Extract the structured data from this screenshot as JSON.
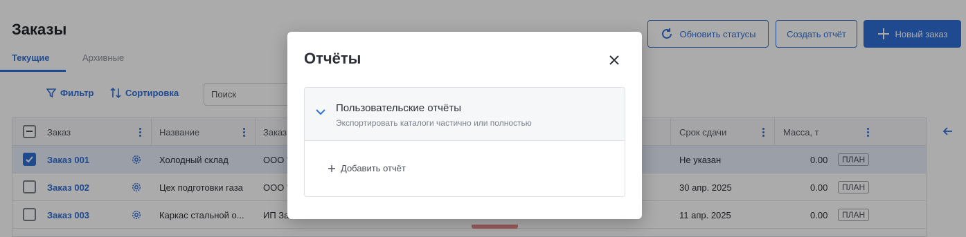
{
  "page": {
    "title": "Заказы",
    "tabs": [
      {
        "label": "Текущие",
        "active": true
      },
      {
        "label": "Архивные",
        "active": false
      }
    ]
  },
  "header_buttons": {
    "refresh": "Обновить статусы",
    "create_report": "Создать отчёт",
    "new_order": "Новый заказ"
  },
  "toolbar": {
    "filter": "Фильтр",
    "sort": "Сортировка",
    "search_placeholder": "Поиск"
  },
  "table": {
    "columns": {
      "order": "Заказ",
      "name": "Название",
      "customer": "Заказ",
      "deadline": "Срок сдачи",
      "mass": "Масса, т"
    },
    "rows": [
      {
        "order": "Заказ 001",
        "name": "Холодный склад",
        "customer": "ООО \"",
        "deadline": "Не указан",
        "mass": "0.00",
        "badge": "ПЛАН",
        "checked": true
      },
      {
        "order": "Заказ 002",
        "name": "Цех подготовки газа",
        "customer": "ООО \"",
        "deadline": "30 апр. 2025",
        "mass": "0.00",
        "badge": "ПЛАН",
        "checked": false
      },
      {
        "order": "Заказ 003",
        "name": "Каркас стальной о...",
        "customer": "ИП За",
        "deadline": "11 апр. 2025",
        "mass": "0.00",
        "badge": "ПЛАН",
        "checked": false
      }
    ]
  },
  "modal": {
    "title": "Отчёты",
    "section_title": "Пользовательские отчёты",
    "section_subtitle": "Экспортировать каталоги частично или полностью",
    "add_report": "Добавить отчёт"
  },
  "colors": {
    "accent": "#2f6fd6",
    "overlay": "rgba(0,0,0,0.33)"
  }
}
